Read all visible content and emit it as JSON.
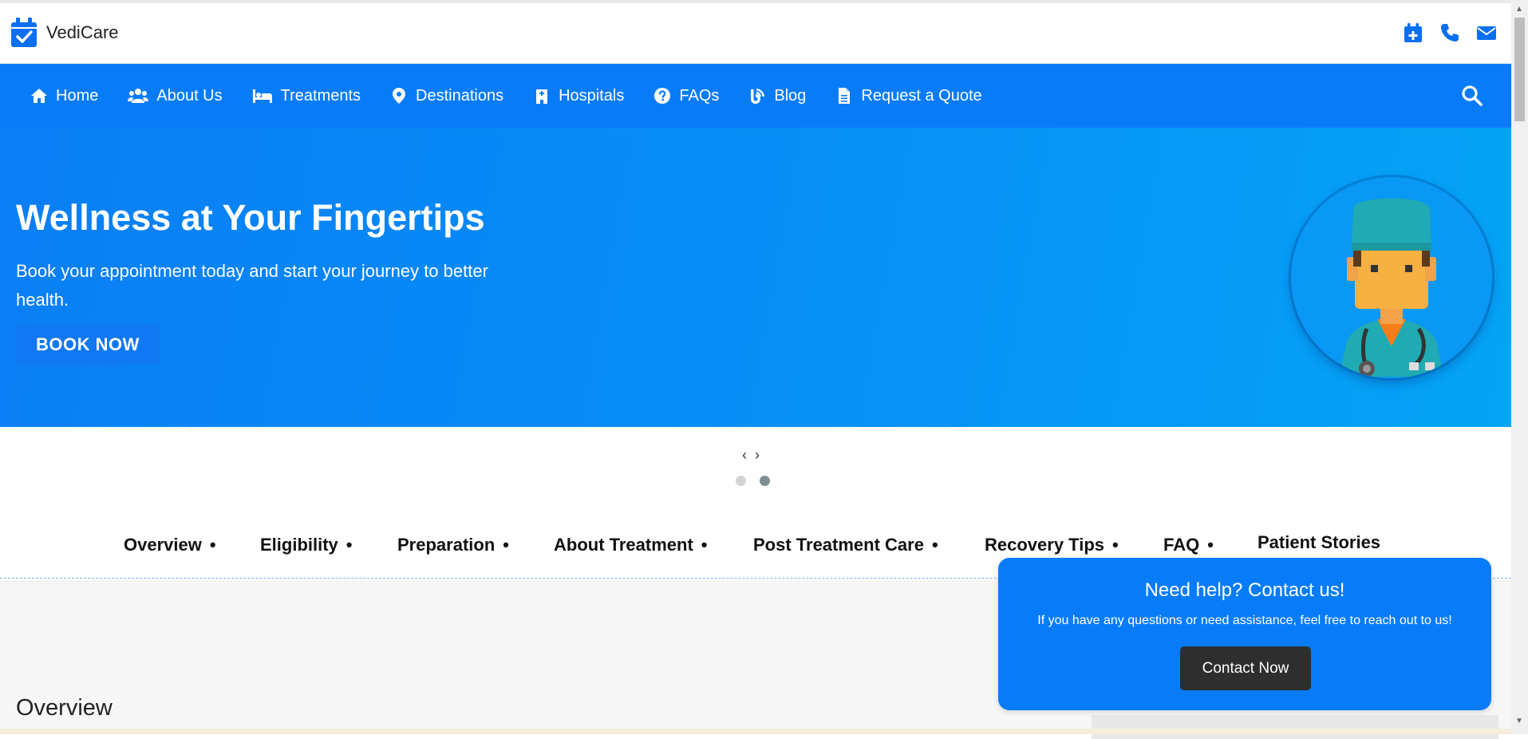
{
  "brand": {
    "name": "VediCare",
    "color": "#0a6ff0"
  },
  "header_icons": [
    "calendar-plus-icon",
    "phone-icon",
    "envelope-icon"
  ],
  "nav": {
    "items": [
      {
        "label": "Home",
        "icon": "home-icon"
      },
      {
        "label": "About Us",
        "icon": "users-icon"
      },
      {
        "label": "Treatments",
        "icon": "bed-icon"
      },
      {
        "label": "Destinations",
        "icon": "map-marker-icon"
      },
      {
        "label": "Hospitals",
        "icon": "hospital-icon"
      },
      {
        "label": "FAQs",
        "icon": "question-circle-icon"
      },
      {
        "label": "Blog",
        "icon": "blog-icon"
      },
      {
        "label": "Request a Quote",
        "icon": "document-icon"
      }
    ],
    "search_icon": "search-icon",
    "background": "#087cf8"
  },
  "hero": {
    "title": "Wellness at Your Fingertips",
    "subtitle": "Book your appointment today and start your journey to better health.",
    "button": "BOOK NOW",
    "image": "doctor-avatar"
  },
  "slider": {
    "prev": "‹",
    "next": "›",
    "dots": 2,
    "active_dot": 2
  },
  "tabs": [
    {
      "label": "Overview",
      "sep": "•"
    },
    {
      "label": "Eligibility",
      "sep": "•"
    },
    {
      "label": "Preparation",
      "sep": "•"
    },
    {
      "label": "About Treatment",
      "sep": "•"
    },
    {
      "label": "Post Treatment Care",
      "sep": "•"
    },
    {
      "label": "Recovery Tips",
      "sep": "•"
    },
    {
      "label": "FAQ",
      "sep": "•"
    },
    {
      "label": "Patient Stories",
      "sep": ""
    }
  ],
  "content": {
    "section_title": "Overview"
  },
  "help": {
    "title": "Need help? Contact us!",
    "text": "If you have any questions or need assistance, feel free to reach out to us!",
    "button": "Contact Now"
  }
}
